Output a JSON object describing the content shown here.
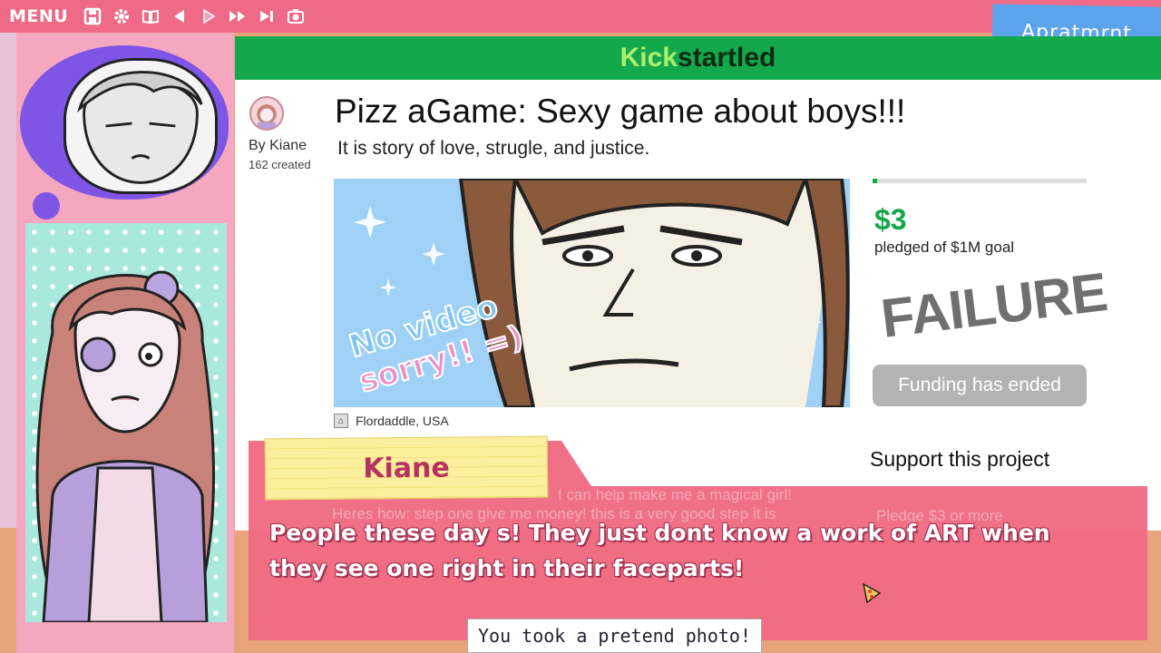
{
  "topbar": {
    "menu_label": "MENU",
    "icons": [
      "save-icon",
      "settings-icon",
      "log-book-icon",
      "back-icon",
      "play-icon",
      "fast-forward-icon",
      "skip-icon",
      "camera-icon"
    ]
  },
  "room_tag": "Apratmrnt",
  "site": {
    "brand_kick": "Kick",
    "brand_rest": "startled",
    "accent_color": "#14a84c"
  },
  "project": {
    "title": "Pizz aGame: Sexy game about boys!!!",
    "tagline": "It is story of love, strugle, and justice.",
    "creator_by": "By Kiane",
    "creator_count": "162 created",
    "video_caption_line1": "No video",
    "video_caption_line2": "sorry!! =)",
    "location": "Flordaddle, USA",
    "pledged_amount": "$3",
    "pledged_label": "pledged of $1M goal",
    "progress_fraction": 0.01,
    "stamp": "FAILURE",
    "funding_status": "Funding has ended",
    "support_title": "Support this project",
    "faded_line1": "I can help make me a magical girl!",
    "faded_line2": "Heres how: step one give me money! this is a very good step it is",
    "faded_pledge": "Pledge $3 or more"
  },
  "dialogue": {
    "speaker": "Kiane",
    "text": "People these day s! They just dont know a work of ART when they see one right in their faceparts!"
  },
  "toast": "You took a pretend photo!"
}
